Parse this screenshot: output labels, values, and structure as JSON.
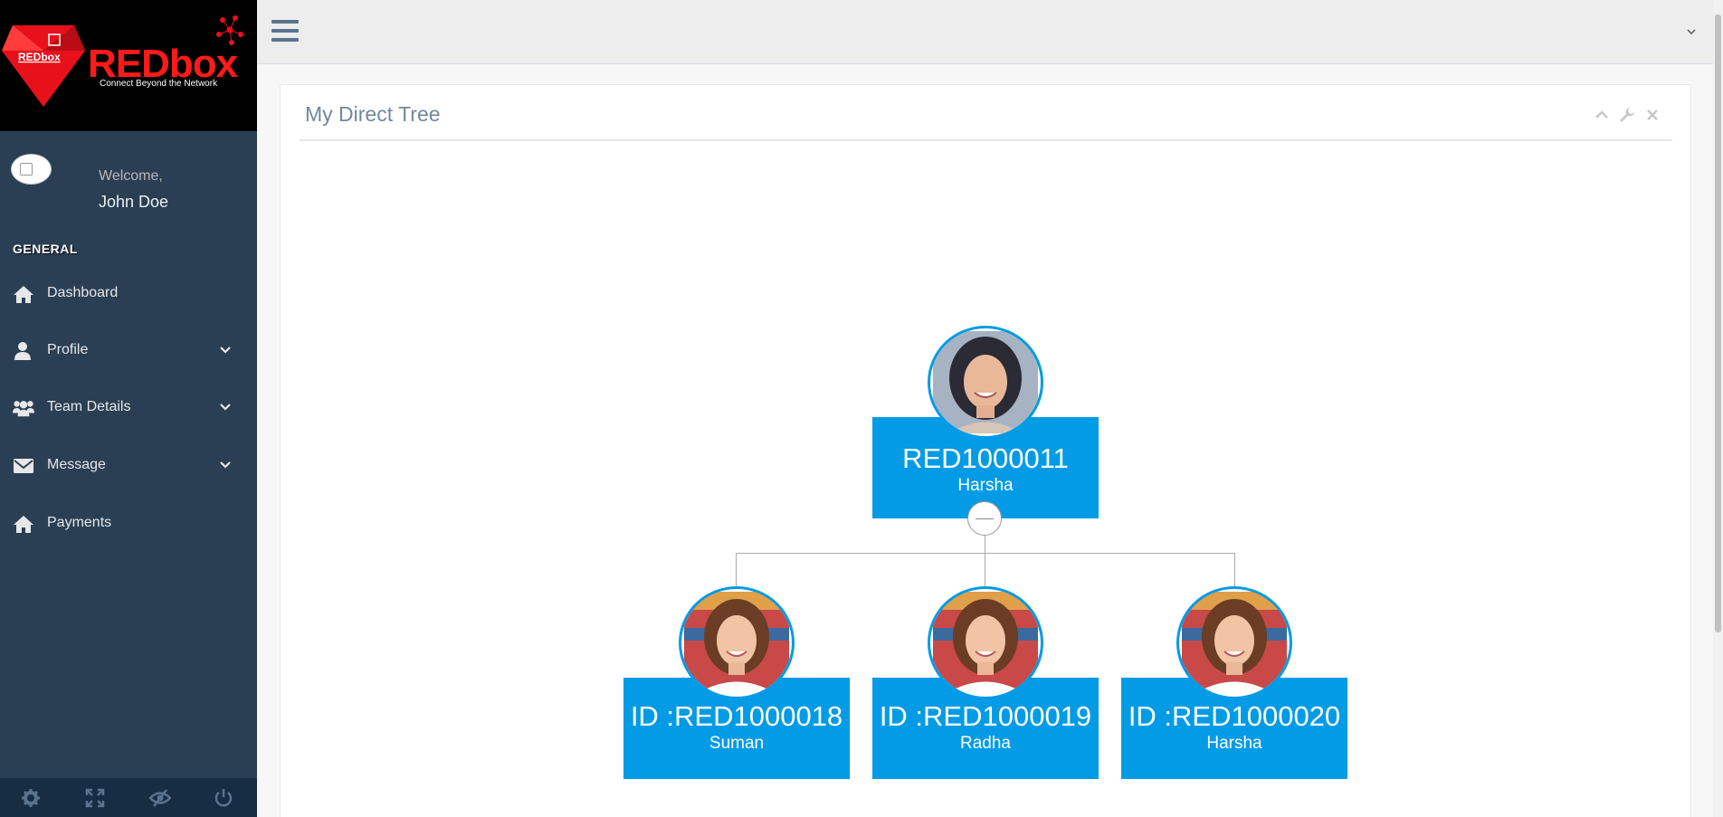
{
  "brand": {
    "name": "REDbox",
    "badge": "REDbox",
    "tagline": "Connect Beyond the Network",
    "color": "#ff1a1a"
  },
  "profile": {
    "welcome": "Welcome,",
    "name": "John Doe"
  },
  "sidebar": {
    "section": "GENERAL",
    "items": [
      {
        "label": "Dashboard",
        "icon": "home-icon",
        "expandable": false
      },
      {
        "label": "Profile",
        "icon": "user-icon",
        "expandable": true
      },
      {
        "label": "Team Details",
        "icon": "users-icon",
        "expandable": true
      },
      {
        "label": "Message",
        "icon": "envelope-icon",
        "expandable": true
      },
      {
        "label": "Payments",
        "icon": "home-icon",
        "expandable": false
      }
    ],
    "footer_icons": [
      "gear-icon",
      "fullscreen-icon",
      "eye-slash-icon",
      "power-icon"
    ]
  },
  "panel": {
    "title": "My Direct Tree",
    "tools": [
      "chevron-up-icon",
      "wrench-icon",
      "close-icon"
    ]
  },
  "tree": {
    "root": {
      "id": "RED1000011",
      "name": "Harsha"
    },
    "children": [
      {
        "id": "ID :RED1000018",
        "name": "Suman"
      },
      {
        "id": "ID :RED1000019",
        "name": "Radha"
      },
      {
        "id": "ID :RED1000020",
        "name": "Harsha"
      }
    ]
  },
  "colors": {
    "sidebar": "#2a3f54",
    "node": "#039be5",
    "topbar": "#ededed"
  }
}
